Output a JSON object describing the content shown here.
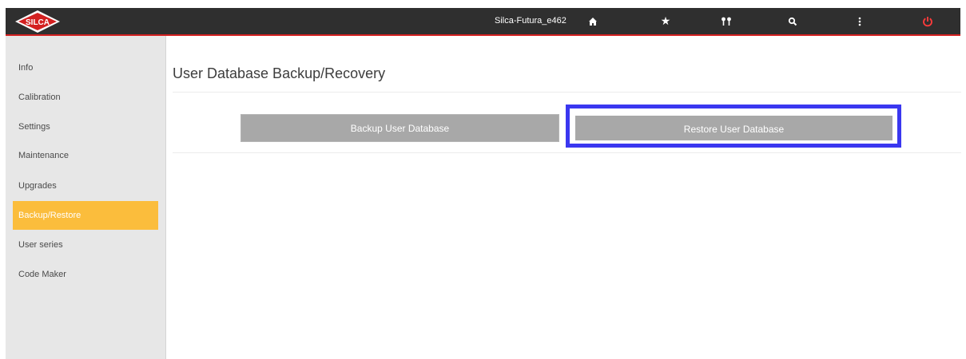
{
  "header": {
    "logo_text": "SILCA",
    "device_name": "Silca-Futura_e462",
    "icons": [
      "home-icon",
      "star-icon",
      "keys-icon",
      "search-icon",
      "more-vertical-icon",
      "power-icon"
    ],
    "accent_color": "#d42121"
  },
  "sidebar": {
    "items": [
      {
        "label": "Info"
      },
      {
        "label": "Calibration"
      },
      {
        "label": "Settings"
      },
      {
        "label": "Maintenance"
      },
      {
        "label": "Upgrades"
      },
      {
        "label": "Backup/Restore",
        "active": true
      },
      {
        "label": "User series"
      },
      {
        "label": "Code Maker"
      }
    ],
    "active_color": "#fbbd3c"
  },
  "main": {
    "title": "User Database Backup/Recovery",
    "backup_button": "Backup User Database",
    "restore_button": "Restore User Database",
    "highlight_color": "#3a37f0"
  }
}
